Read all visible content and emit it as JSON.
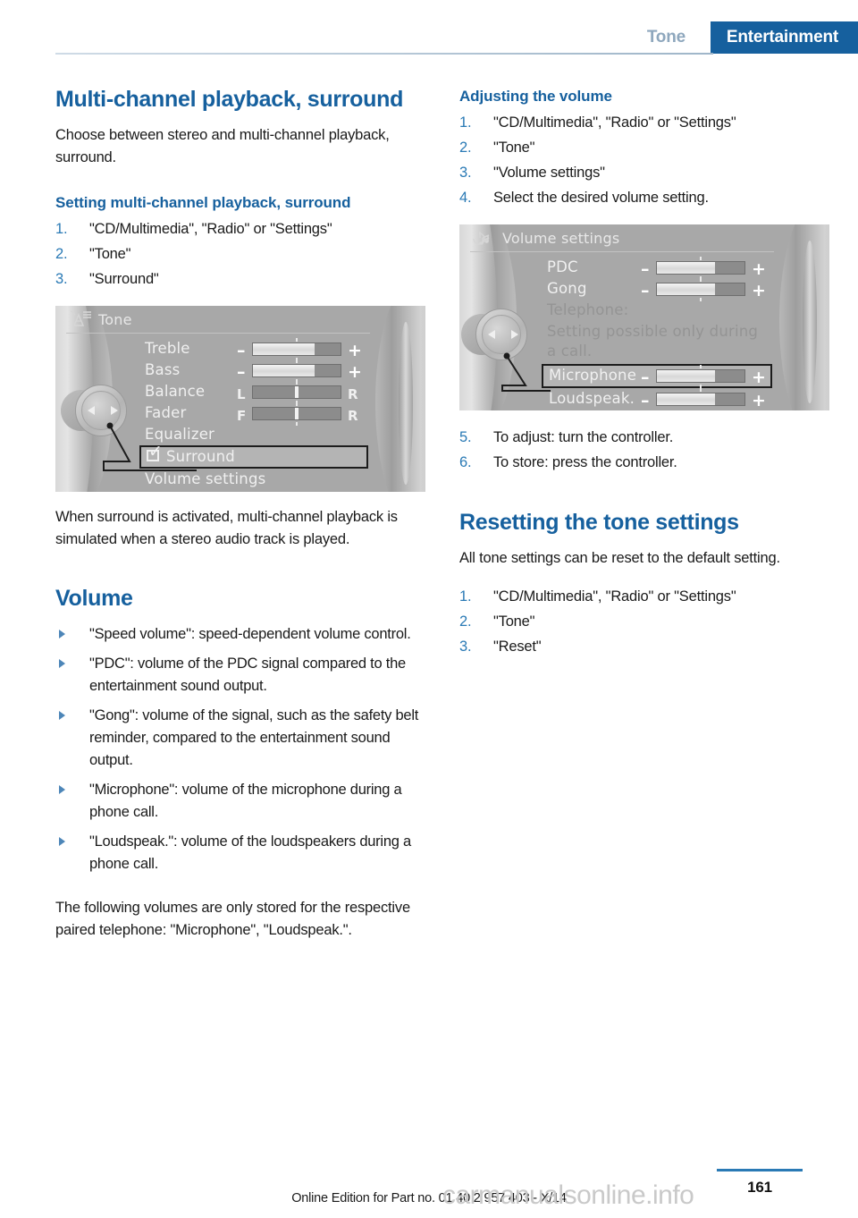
{
  "header": {
    "inactive_tab": "Tone",
    "active_tab": "Entertainment",
    "accent_color": "#16609e"
  },
  "left_column": {
    "title": "Multi-channel playback, surround",
    "intro": "Choose between stereo and multi-channel playback, surround.",
    "subtitle": "Setting multi-channel playback, surround",
    "steps": [
      {
        "num": "1.",
        "text": "\"CD/Multimedia\", \"Radio\" or \"Settings\""
      },
      {
        "num": "2.",
        "text": "\"Tone\""
      },
      {
        "num": "3.",
        "text": "\"Surround\""
      }
    ],
    "after_figure": "When surround is activated, multi-channel playback is simulated when a stereo audio track is played.",
    "volume_heading": "Volume",
    "bullets": [
      "\"Speed volume\": speed-dependent volume control.",
      "\"PDC\": volume of the PDC signal compared to the entertainment sound output.",
      "\"Gong\": volume of the signal, such as the safety belt reminder, compared to the entertainment sound output.",
      "\"Microphone\": volume of the microphone during a phone call.",
      "\"Loudspeak.\": volume of the loudspeakers during a phone call."
    ],
    "closing": "The following volumes are only stored for the respective paired telephone: \"Microphone\", \"Loudspeak.\"."
  },
  "right_column": {
    "subtitle": "Adjusting the volume",
    "steps_a": [
      {
        "num": "1.",
        "text": "\"CD/Multimedia\", \"Radio\" or \"Settings\""
      },
      {
        "num": "2.",
        "text": "\"Tone\""
      },
      {
        "num": "3.",
        "text": "\"Volume settings\""
      },
      {
        "num": "4.",
        "text": "Select the desired volume setting."
      }
    ],
    "steps_b": [
      {
        "num": "5.",
        "text": "To adjust: turn the controller."
      },
      {
        "num": "6.",
        "text": "To store: press the controller."
      }
    ],
    "reset_heading": "Resetting the tone settings",
    "reset_intro": "All tone settings can be reset to the default setting.",
    "steps_c": [
      {
        "num": "1.",
        "text": "\"CD/Multimedia\", \"Radio\" or \"Settings\""
      },
      {
        "num": "2.",
        "text": "\"Tone\""
      },
      {
        "num": "3.",
        "text": "\"Reset\""
      }
    ]
  },
  "figure_tone": {
    "icon": "tone-speaker-icon",
    "screen_title": "Tone",
    "rows": [
      {
        "label": "Treble",
        "type": "plusminus",
        "minus": "–",
        "plus": "+",
        "fill_pct": 70
      },
      {
        "label": "Bass",
        "type": "plusminus",
        "minus": "–",
        "plus": "+",
        "fill_pct": 70
      },
      {
        "label": "Balance",
        "type": "lr",
        "left_label": "L",
        "right_label": "R",
        "center_pct": 50
      },
      {
        "label": "Fader",
        "type": "lr",
        "left_label": "F",
        "right_label": "R",
        "center_pct": 50
      },
      {
        "label": "Equalizer",
        "type": "plain"
      },
      {
        "label": "Surround",
        "type": "checkbox",
        "checked": true,
        "highlighted": true
      },
      {
        "label": "Volume settings",
        "type": "plain"
      }
    ]
  },
  "figure_volume": {
    "icon": "volume-note-icon",
    "screen_title": "Volume settings",
    "rows": [
      {
        "label": "PDC",
        "type": "plusminus",
        "minus": "–",
        "plus": "+",
        "fill_pct": 66
      },
      {
        "label": "Gong",
        "type": "plusminus",
        "minus": "–",
        "plus": "+",
        "fill_pct": 66
      },
      {
        "label": "Telephone:",
        "type": "plain",
        "dim": true
      },
      {
        "label": "Setting possible only during",
        "type": "plain",
        "dim": true
      },
      {
        "label": "a call.",
        "type": "plain",
        "dim": true
      },
      {
        "label": "Microphone",
        "type": "plusminus",
        "minus": "–",
        "plus": "+",
        "fill_pct": 66,
        "highlighted": true
      },
      {
        "label": "Loudspeak.",
        "type": "plusminus",
        "minus": "–",
        "plus": "+",
        "fill_pct": 66
      }
    ]
  },
  "footer": {
    "edition": "Online Edition for Part no. 01 40 2 957 403 - X/14",
    "page_number": "161",
    "watermark": "carmanualsonline.info"
  }
}
